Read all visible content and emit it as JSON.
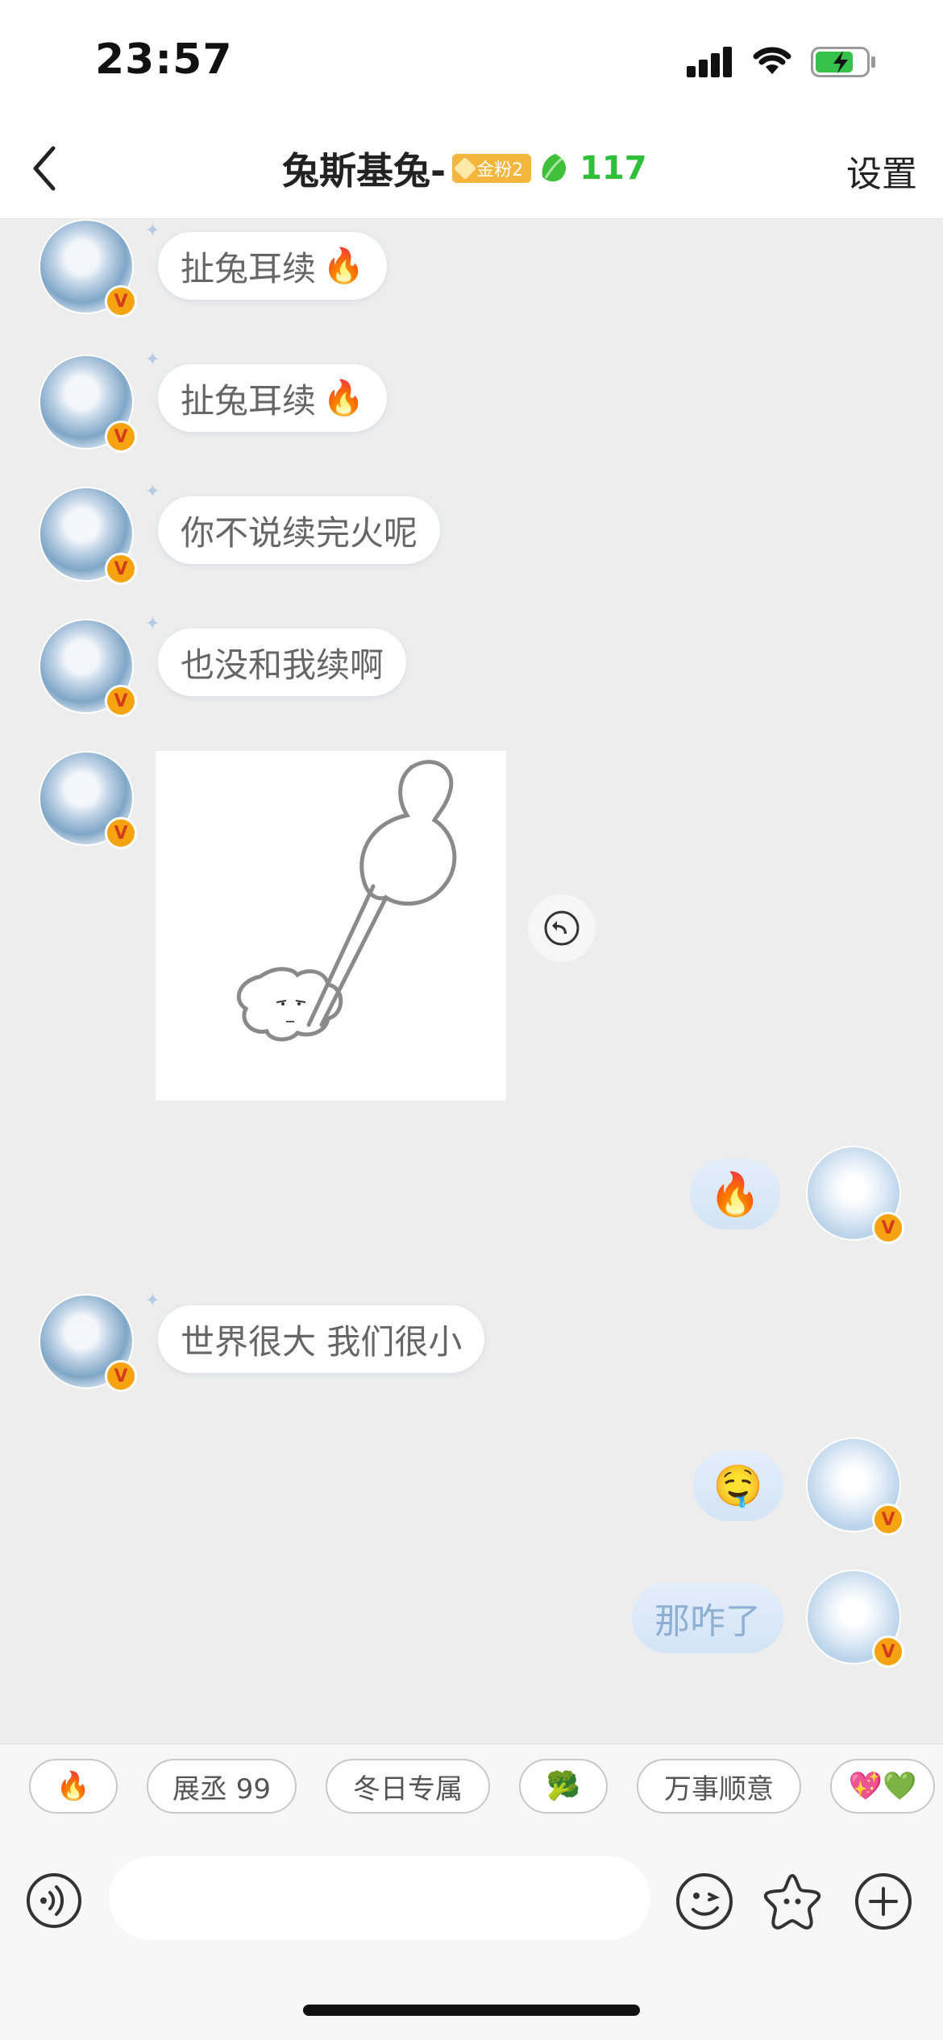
{
  "status_bar": {
    "time": "23:57"
  },
  "nav": {
    "title": "兔斯基兔-",
    "fan_badge": "金粉2",
    "leaf_count": "117",
    "settings_label": "设置"
  },
  "messages": [
    {
      "side": "left",
      "type": "text",
      "text": "扯兔耳续",
      "emoji": "🔥"
    },
    {
      "side": "left",
      "type": "text",
      "text": "扯兔耳续",
      "emoji": "🔥"
    },
    {
      "side": "left",
      "type": "text",
      "text": "你不说续完火呢",
      "emoji": ""
    },
    {
      "side": "left",
      "type": "text",
      "text": "也没和我续啊",
      "emoji": ""
    },
    {
      "side": "left",
      "type": "image"
    },
    {
      "side": "right",
      "type": "emoji",
      "text": "🔥"
    },
    {
      "side": "left",
      "type": "text",
      "text": "世界很大 我们很小",
      "emoji": ""
    },
    {
      "side": "right",
      "type": "emoji",
      "text": "🤤"
    },
    {
      "side": "right",
      "type": "text",
      "text": "那咋了"
    }
  ],
  "quick_replies": [
    "🔥",
    "展丞 99",
    "冬日专属",
    "🥦",
    "万事顺意",
    "💖💚"
  ],
  "input": {
    "value": "",
    "placeholder": ""
  },
  "colors": {
    "accent_green": "#2fbf3a",
    "badge_gold": "#f4b63c",
    "bubble_out": "#d4e4f6"
  }
}
